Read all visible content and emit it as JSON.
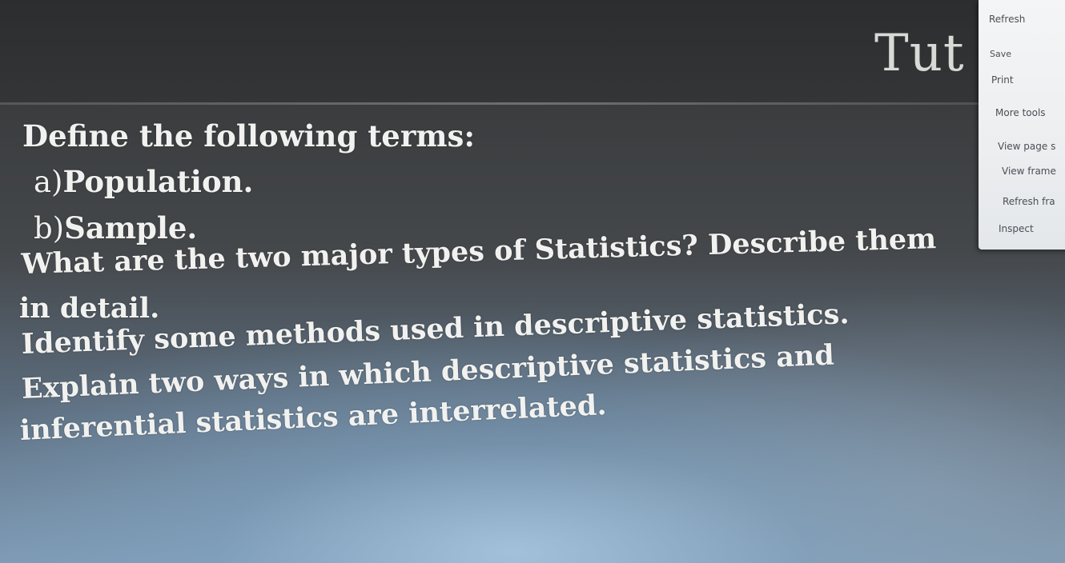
{
  "slide": {
    "title": "Tut",
    "lines": [
      {
        "text": "Define the following terms:"
      },
      {
        "mark": "a)",
        "text": "Population."
      },
      {
        "mark": "b)",
        "text": "Sample."
      },
      {
        "text": "What are the two major types of Statistics? Describe them"
      },
      {
        "text": "in detail."
      },
      {
        "text": "Identify some methods used in descriptive statistics."
      },
      {
        "text": "Explain two ways in which descriptive statistics and"
      },
      {
        "text": "inferential statistics are interrelated."
      }
    ]
  },
  "context_menu": {
    "items": [
      "Refresh",
      "Save",
      "Print",
      "More tools",
      "View page s",
      "View frame",
      "Refresh fra",
      "Inspect"
    ]
  }
}
